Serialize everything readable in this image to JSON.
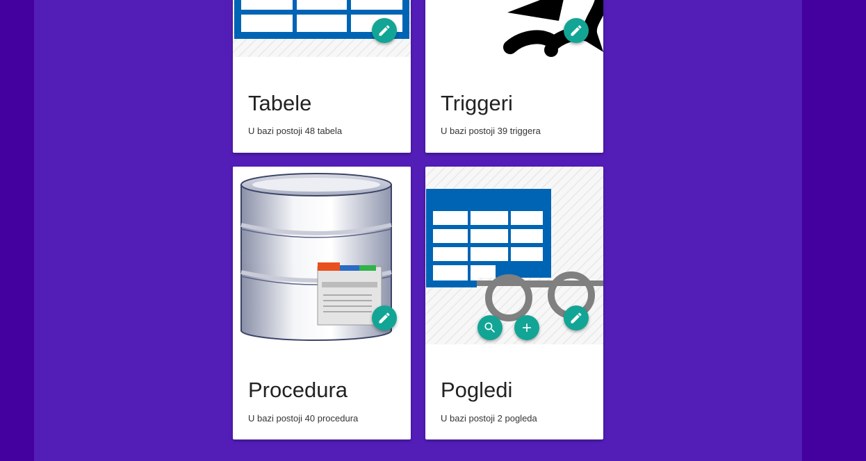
{
  "cards": [
    {
      "title": "Tabele",
      "subtitle": "U bazi postoji 48 tabela"
    },
    {
      "title": "Triggeri",
      "subtitle": "U bazi postoji 39 triggera"
    },
    {
      "title": "Procedura",
      "subtitle": "U bazi postoji 40 procedura"
    },
    {
      "title": "Pogledi",
      "subtitle": "U bazi postoji 2 pogleda"
    }
  ],
  "icons": {
    "edit": "pencil-icon",
    "search": "search-icon",
    "add": "plus-icon"
  },
  "colors": {
    "page_background": "#4500a0",
    "panel_background": "#531db8",
    "fab": "#12a595",
    "table_blue": "#0064b4"
  }
}
